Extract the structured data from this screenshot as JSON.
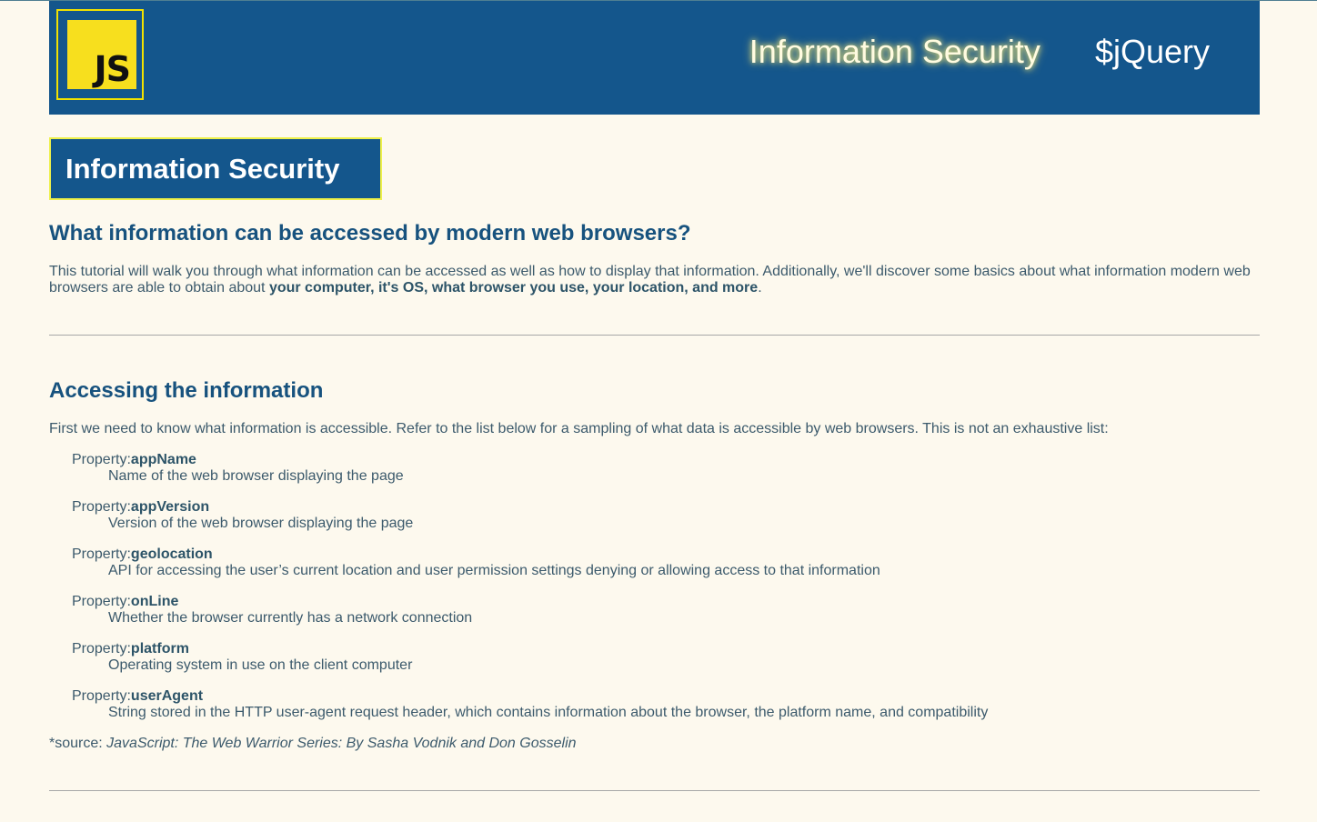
{
  "header": {
    "logo_text": "JS",
    "nav": [
      {
        "label": "Information Security",
        "active": true
      },
      {
        "label": "$jQuery",
        "active": false
      }
    ]
  },
  "page_title": "Information Security",
  "intro": {
    "heading": "What information can be accessed by modern web browsers?",
    "text": "This tutorial will walk you through what information can be accessed as well as how to display that information. Additionally, we'll discover some basics about what information modern web browsers are able to obtain about ",
    "bold": "your computer, it's OS, what browser you use, your location, and more",
    "end": "."
  },
  "access": {
    "heading": "Accessing the information",
    "text": "First we need to know what information is accessible. Refer to the list below for a sampling of what data is accessible by web browsers. This is not an exhaustive list:",
    "property_prefix": "Property:",
    "properties": [
      {
        "name": "appName",
        "desc": "Name of the web browser displaying the page"
      },
      {
        "name": "appVersion",
        "desc": "Version of the web browser displaying the page"
      },
      {
        "name": "geolocation",
        "desc": "API for accessing the user’s current location and user permission settings denying or allowing access to that information"
      },
      {
        "name": "onLine",
        "desc": "Whether the browser currently has a network connection"
      },
      {
        "name": "platform",
        "desc": "Operating system in use on the client computer"
      },
      {
        "name": "userAgent",
        "desc": "String stored in the HTTP user-agent request header, which contains information about the browser, the platform name, and compatibility"
      }
    ],
    "source_prefix": "*source: ",
    "source_title": "JavaScript: The Web Warrior Series: By Sasha Vodnik and Don Gosselin"
  },
  "colors": {
    "background": "#fdf9ee",
    "header": "#14568c",
    "accent_yellow": "#f7df1e",
    "heading": "#17527e",
    "text": "#3c5a6c"
  }
}
